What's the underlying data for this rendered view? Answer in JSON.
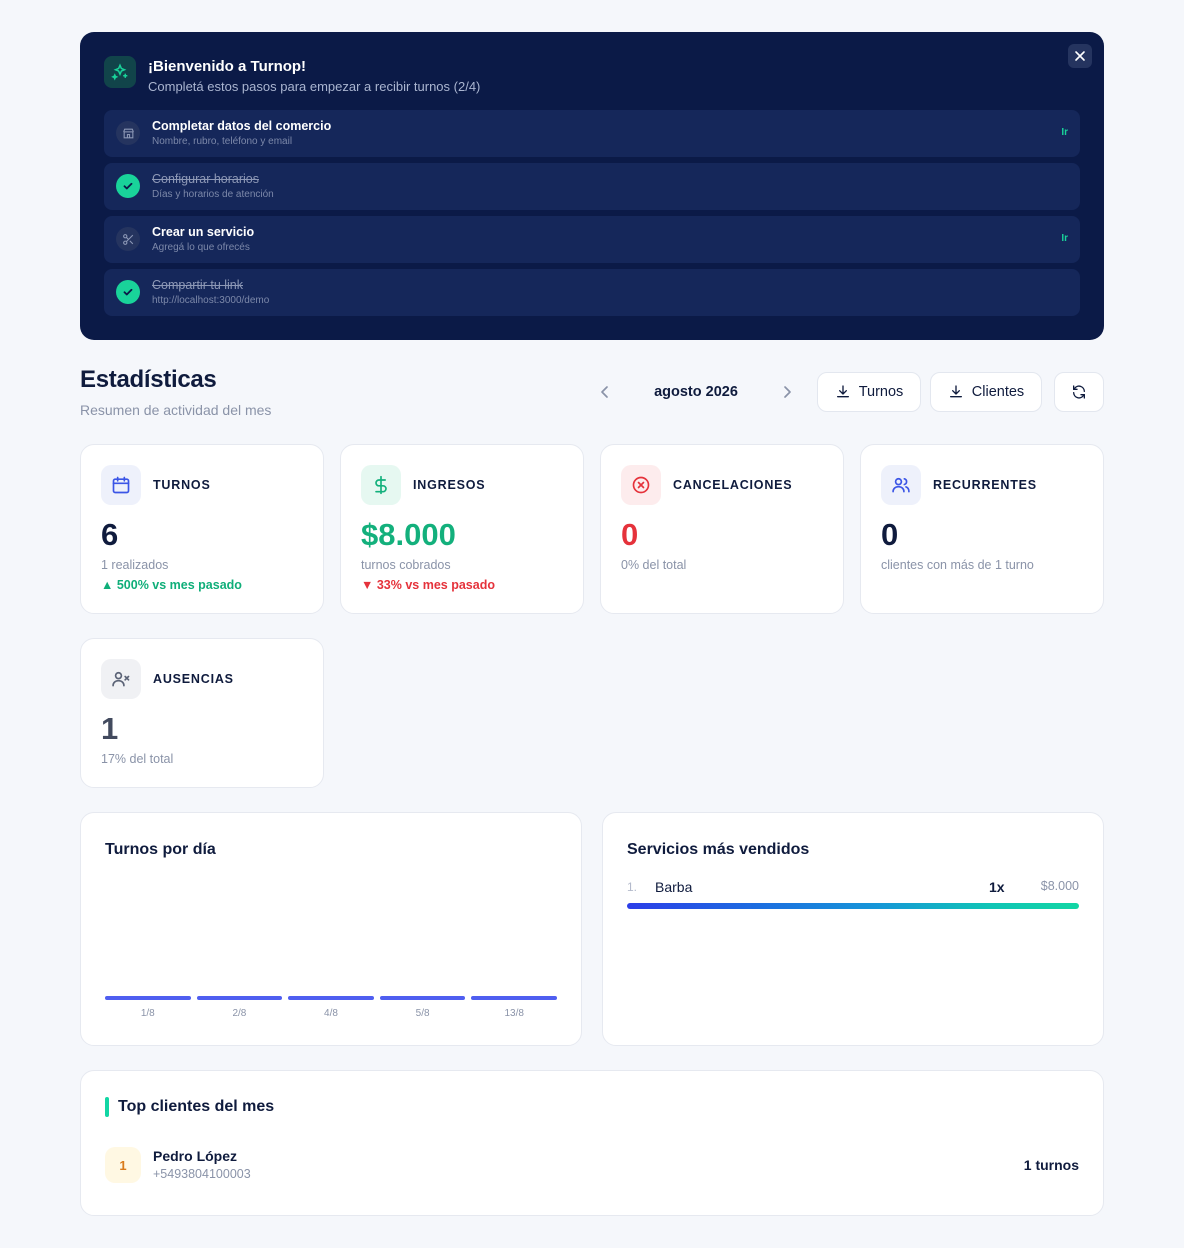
{
  "onboarding": {
    "title": "¡Bienvenido a Turnop!",
    "subtitle": "Completá estos pasos para empezar a recibir turnos (2/4)",
    "steps": [
      {
        "label": "Completar datos del comercio",
        "desc": "Nombre, rubro, teléfono y email",
        "done": false,
        "action": "Ir",
        "icon": "store-icon"
      },
      {
        "label": "Configurar horarios",
        "desc": "Días y horarios de atención",
        "done": true,
        "icon": "check-icon"
      },
      {
        "label": "Crear un servicio",
        "desc": "Agregá lo que ofrecés",
        "done": false,
        "action": "Ir",
        "icon": "scissors-icon"
      },
      {
        "label": "Compartir tu link",
        "desc": "http://localhost:3000/demo",
        "done": true,
        "icon": "check-icon"
      }
    ]
  },
  "header": {
    "title": "Estadísticas",
    "subtitle": "Resumen de actividad del mes",
    "month": "agosto 2026",
    "btn_turnos": "Turnos",
    "btn_clientes": "Clientes"
  },
  "stats": [
    {
      "label": "TURNOS",
      "value": "6",
      "desc": "1 realizados",
      "trend": "▲ 500% vs mes pasado",
      "trend_dir": "up",
      "icon": "calendar-icon",
      "value_color": "#0f1b3d",
      "icon_bg": "#eef1fb",
      "icon_color": "#3b55e6"
    },
    {
      "label": "INGRESOS",
      "value": "$8.000",
      "desc": "turnos cobrados",
      "trend": "▼ 33% vs mes pasado",
      "trend_dir": "down",
      "icon": "dollar-icon",
      "value_color": "#13b07c",
      "icon_bg": "#e6f8f1",
      "icon_color": "#13b07c"
    },
    {
      "label": "CANCELACIONES",
      "value": "0",
      "desc": "0% del total",
      "icon": "x-circle-icon",
      "value_color": "#e5323b",
      "icon_bg": "#fdeced",
      "icon_color": "#e5323b"
    },
    {
      "label": "RECURRENTES",
      "value": "0",
      "desc": "clientes con más de 1 turno",
      "icon": "users-icon",
      "value_color": "#0f1b3d",
      "icon_bg": "#eef1fb",
      "icon_color": "#3b55e6"
    },
    {
      "label": "AUSENCIAS",
      "value": "1",
      "desc": "17% del total",
      "icon": "user-x-icon",
      "value_color": "#424a5e",
      "icon_bg": "#f0f1f4",
      "icon_color": "#5b6376"
    }
  ],
  "chart_panel": {
    "title": "Turnos por día"
  },
  "chart_data": {
    "type": "bar",
    "categories": [
      "1/8",
      "2/8",
      "4/8",
      "5/8",
      "13/8"
    ]
  },
  "services": {
    "title": "Servicios más vendidos",
    "items": [
      {
        "rank": "1.",
        "name": "Barba",
        "count": "1x",
        "amount": "$8.000",
        "share": 1.0
      }
    ]
  },
  "top_clients": {
    "title": "Top clientes del mes",
    "items": [
      {
        "rank": "1",
        "name": "Pedro López",
        "phone": "+5493804100003",
        "count": "1 turnos"
      }
    ]
  }
}
